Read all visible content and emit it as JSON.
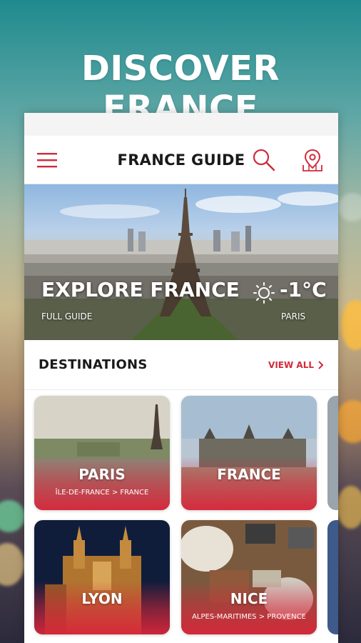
{
  "promo": {
    "headline": "DISCOVER FRANCE"
  },
  "app": {
    "title": "FRANCE GUIDE",
    "menu_icon": "hamburger-menu-icon",
    "search_icon": "search-icon",
    "map_icon": "map-pin-icon"
  },
  "hero": {
    "title": "EXPLORE FRANCE",
    "subtitle": "FULL GUIDE",
    "weather": {
      "icon": "sun-icon",
      "temperature": "-1°C",
      "city": "PARIS"
    }
  },
  "destinations": {
    "title": "DESTINATIONS",
    "view_all": "VIEW ALL",
    "items": [
      {
        "name": "PARIS",
        "region": "ÎLE-DE-FRANCE > FRANCE"
      },
      {
        "name": "FRANCE",
        "region": ""
      },
      {
        "name": "LYON",
        "region": ""
      },
      {
        "name": "NICE",
        "region": "ALPES-MARITIMES > PROVENCE"
      }
    ]
  },
  "colors": {
    "accent": "#d12a3a",
    "text_dark": "#1a1a1a",
    "white": "#ffffff"
  }
}
